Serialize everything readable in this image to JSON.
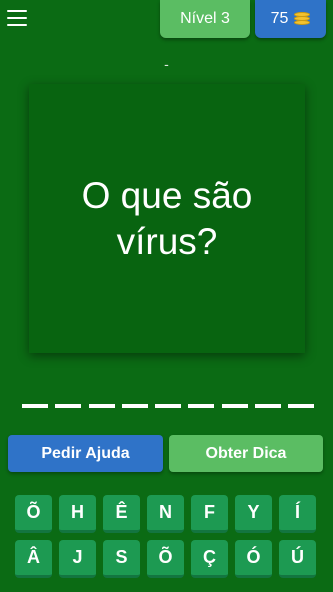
{
  "header": {
    "menu_icon": "hamburger-menu-icon",
    "level_label": "Nível 3",
    "coins": "75",
    "coin_icon": "coin-stack-icon"
  },
  "hint_line": "-",
  "question": "O que são vírus?",
  "answer_slot_count": 9,
  "buttons": {
    "help_label": "Pedir Ajuda",
    "tip_label": "Obter Dica"
  },
  "keyboard": {
    "row1": [
      "Õ",
      "H",
      "Ê",
      "N",
      "F",
      "Y",
      "Í"
    ],
    "row2": [
      "Â",
      "J",
      "S",
      "Õ",
      "Ç",
      "Ó",
      "Ú"
    ]
  },
  "colors": {
    "background": "#0b6b14",
    "card": "#086410",
    "level_badge": "#5bbd63",
    "coins_badge": "#2f73c8",
    "help_button": "#2f73c8",
    "tip_button": "#5bbd63",
    "key": "#1d9a52"
  }
}
